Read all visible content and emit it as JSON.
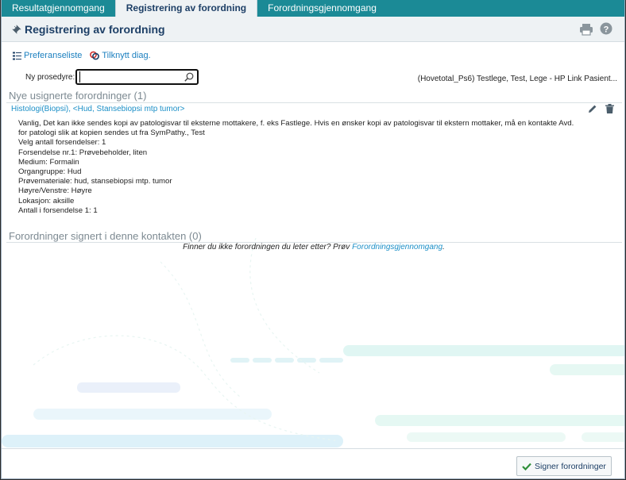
{
  "tabs": [
    {
      "label": "Resultatgjennomgang",
      "active": false
    },
    {
      "label": "Registrering av forordning",
      "active": true
    },
    {
      "label": "Forordningsgjennomgang",
      "active": false
    }
  ],
  "header": {
    "title": "Registrering av forordning"
  },
  "toolbar": {
    "preferences_label": "Preferanseliste",
    "link_diag_label": "Tilknytt diag."
  },
  "new_procedure": {
    "label": "Ny prosedyre:",
    "value": "",
    "placeholder": ""
  },
  "patient_info": "(Hovetotal_Ps6) Testlege, Test, Lege - HP Link Pasient...",
  "unsigned": {
    "title": "Nye usignerte forordninger (1)",
    "order": {
      "header": "Histologi(Biopsi), <Hud, Stansebiopsi mtp tumor>",
      "lines": [
        "Vanlig, Det kan ikke sendes kopi av patologisvar til eksterne mottakere, f. eks Fastlege. Hvis en ønsker kopi av patologisvar til ekstern mottaker, må en kontakte Avd. for patologi slik at kopien sendes ut fra SymPathy., Test",
        "Velg antall forsendelser: 1",
        "Forsendelse nr.1: Prøvebeholder, liten",
        "Medium: Formalin",
        "Organgruppe: Hud",
        "Prøvemateriale: hud, stansebiopsi mtp. tumor",
        "Høyre/Venstre: Høyre",
        "Lokasjon: aksille",
        "Antall i forsendelse 1: 1"
      ]
    }
  },
  "signed": {
    "title": "Forordninger signert i denne kontakten (0)",
    "hint_text": "Finner du ikke forordningen du leter etter? Prøv",
    "hint_link": "Forordningsgjennomgang",
    "hint_end": "."
  },
  "footer": {
    "sign_label": "Signer forordninger"
  },
  "colors": {
    "tabbar": "#1b8a96",
    "link": "#1b8fc7",
    "title": "#1d3f66"
  }
}
